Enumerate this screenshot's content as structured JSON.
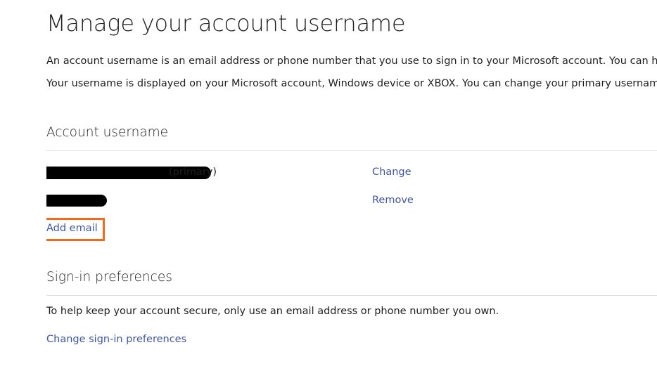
{
  "page": {
    "title": "Manage your account username",
    "intro_1": "An account username is an email address or phone number that you use to sign in to your Microsoft account. You can have multiple",
    "intro_2": "Your username is displayed on your Microsoft account, Windows device or XBOX. You can change your primary username at any tim"
  },
  "account_username": {
    "heading": "Account username",
    "rows": [
      {
        "suffix": "(primary)",
        "action": "Change"
      },
      {
        "suffix": "",
        "action": "Remove"
      }
    ],
    "add_email_label": "Add email"
  },
  "signin_preferences": {
    "heading": "Sign-in preferences",
    "description": "To help keep your account secure, only use an email address or phone number you own.",
    "link_label": "Change sign-in preferences"
  },
  "colors": {
    "link": "#3f56a8",
    "highlight": "#f26a1b",
    "text": "#1f1f1f",
    "rule": "#e1e1e1"
  }
}
